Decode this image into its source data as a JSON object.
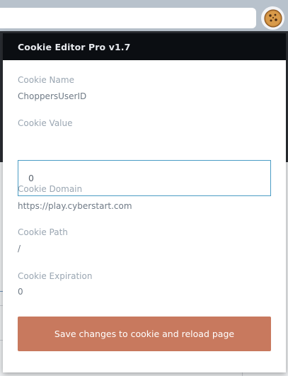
{
  "browser": {
    "address_bar_value": "",
    "extension_icon": "cookie-icon"
  },
  "popup": {
    "title": "Cookie Editor Pro v1.7",
    "fields": {
      "name_label": "Cookie Name",
      "name_value": "ChoppersUserID",
      "value_label": "Cookie Value",
      "value_input": "0",
      "domain_label": "Cookie Domain",
      "domain_value": "https://play.cyberstart.com",
      "path_label": "Cookie Path",
      "path_value": "/",
      "expiration_label": "Cookie Expiration",
      "expiration_value": "0"
    },
    "save_label": "Save changes to cookie and reload page"
  },
  "colors": {
    "header_bg": "#0b0e12",
    "accent_button": "#c8795e",
    "input_border": "#4a9cc4"
  }
}
